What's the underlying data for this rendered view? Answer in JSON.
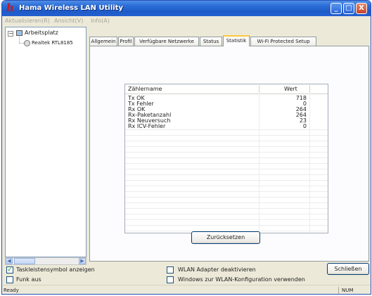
{
  "window": {
    "title": "Hama Wireless LAN Utility",
    "app_icon": "h",
    "controls": {
      "minimize": "_",
      "maximize": "□",
      "close": "X"
    }
  },
  "menu": {
    "items": [
      "Aktualisieren(R)",
      "Ansicht(V)",
      "Info(A)"
    ]
  },
  "tree": {
    "root": {
      "label": "Arbeitsplatz",
      "expander": "⊟"
    },
    "child": {
      "label": "Realtek RTL8185"
    }
  },
  "tabs": [
    {
      "label": "Allgemein"
    },
    {
      "label": "Profil"
    },
    {
      "label": "Verfügbare Netzwerke"
    },
    {
      "label": "Status"
    },
    {
      "label": "Statistik",
      "active": true
    },
    {
      "label": "Wi-Fi Protected Setup"
    }
  ],
  "statistics": {
    "columns": {
      "name": "Zählername",
      "value": "Wert"
    },
    "rows": [
      {
        "name": "Tx OK",
        "value": "718"
      },
      {
        "name": "Tx Fehler",
        "value": "0"
      },
      {
        "name": "Rx OK",
        "value": "264"
      },
      {
        "name": "Rx-Paketanzahl",
        "value": "264"
      },
      {
        "name": "Rx Neuversuch",
        "value": "23"
      },
      {
        "name": "Rx ICV-Fehler",
        "value": "0"
      }
    ],
    "reset_label": "Zurücksetzen"
  },
  "options": {
    "taskbar_icon": {
      "label": "Taskleistensymbol anzeigen",
      "checked": true,
      "mark": "✓"
    },
    "radio_off": {
      "label": "Funk aus",
      "checked": false
    },
    "disable_adapter": {
      "label": "WLAN Adapter deaktivieren",
      "checked": false
    },
    "windows_config": {
      "label": "Windows zur WLAN-Konfiguration verwenden",
      "checked": false
    }
  },
  "close_label": "Schließen",
  "statusbar": {
    "left": "Ready",
    "right": "NUM"
  }
}
